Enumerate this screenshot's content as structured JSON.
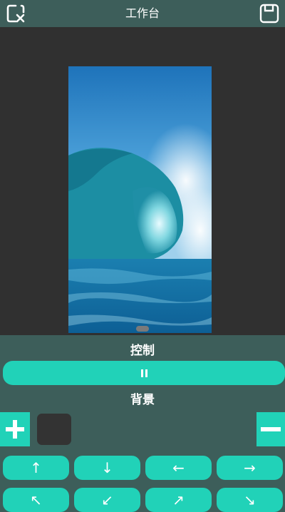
{
  "header": {
    "title": "工作台",
    "left_icon": "close-canvas-icon",
    "right_icon": "save-icon"
  },
  "preview": {
    "image": "ocean-wave-image"
  },
  "control": {
    "label": "控制",
    "pause_icon": "pause-icon"
  },
  "background": {
    "label": "背景",
    "add_icon": "plus-icon",
    "remove_icon": "minus-icon",
    "swatch_color": "#333333"
  },
  "arrows": {
    "row1": [
      "↑",
      "↓",
      "←",
      "→"
    ],
    "row2": [
      "↖",
      "↙",
      "↗",
      "↘"
    ]
  },
  "colors": {
    "accent": "#21d2b8",
    "panel": "#3d5e5a",
    "preview_bg": "#303030"
  }
}
